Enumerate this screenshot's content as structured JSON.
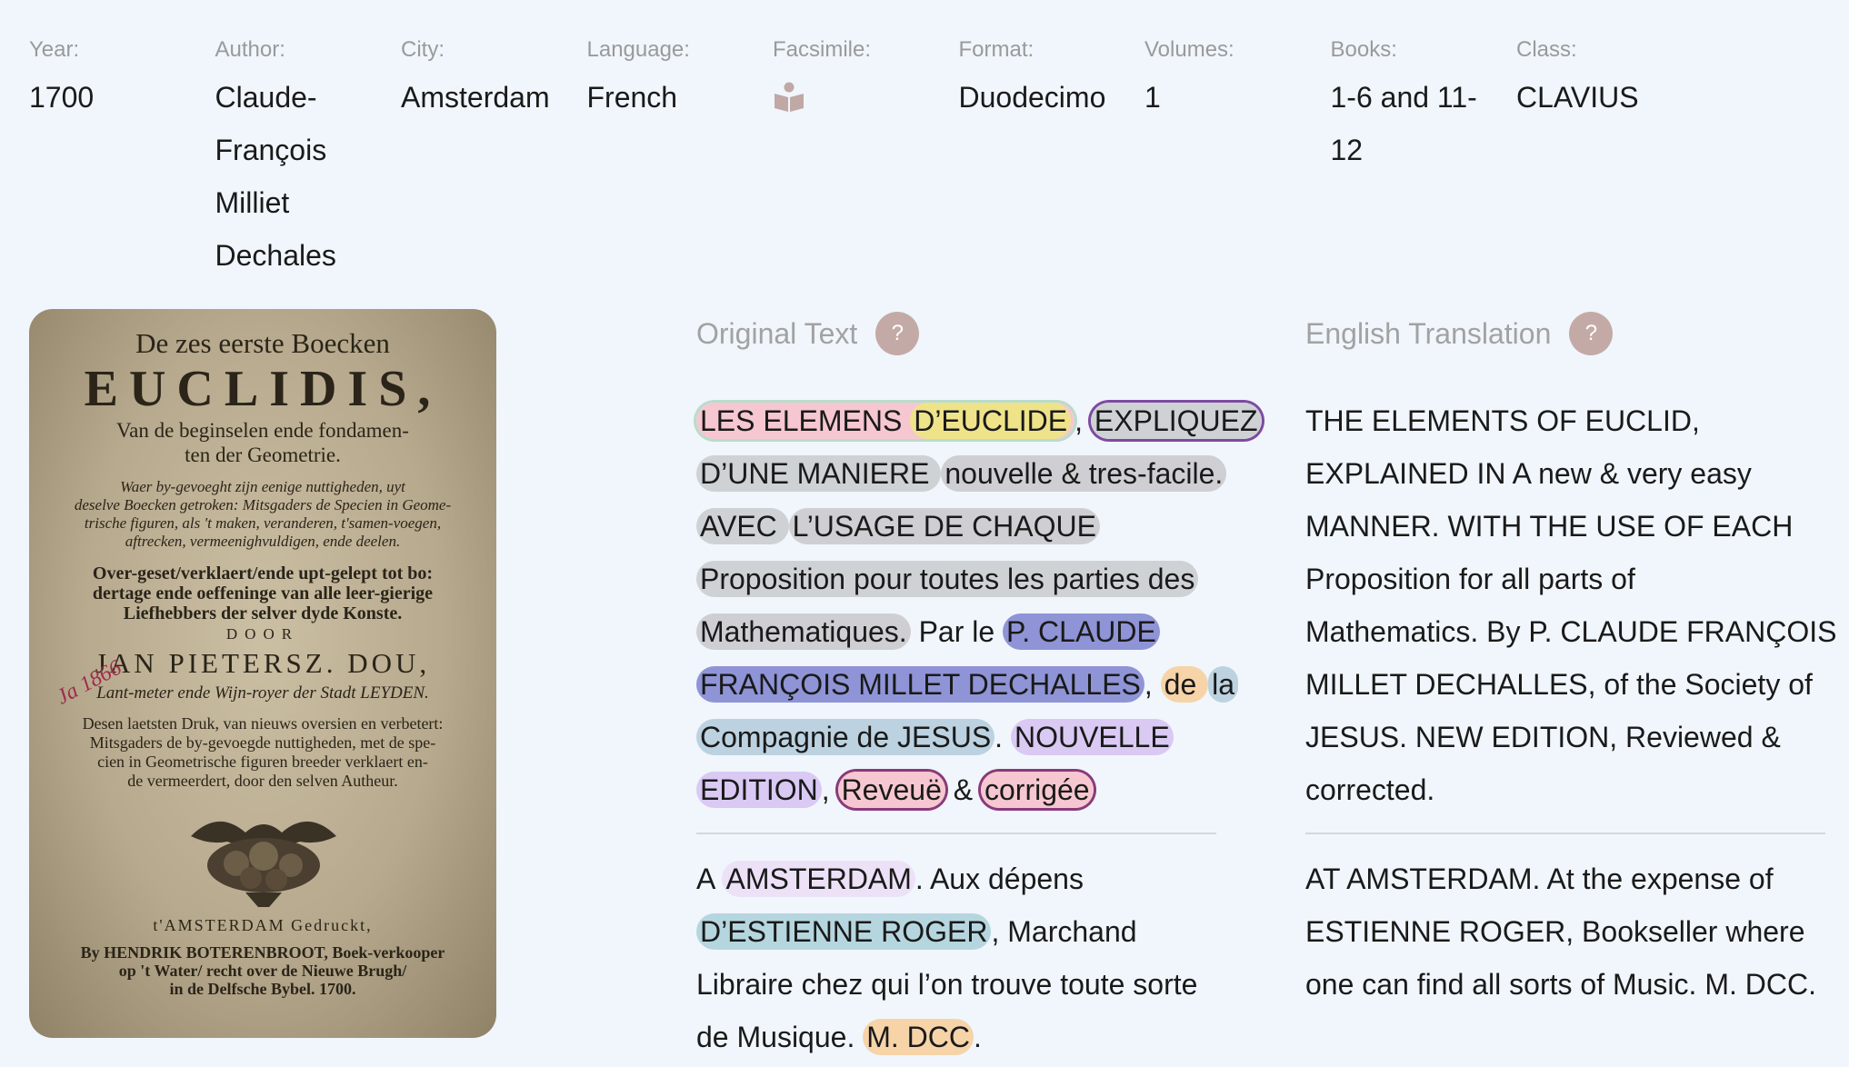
{
  "meta": {
    "year_label": "Year:",
    "year": "1700",
    "author_label": "Author:",
    "author_lines": [
      "Claude-",
      "François",
      "Milliet",
      "Dechales"
    ],
    "city_label": "City:",
    "city": "Amsterdam",
    "language_label": "Language:",
    "language": "French",
    "facsimile_label": "Facsimile:",
    "facsimile_icon": "book-open-icon",
    "format_label": "Format:",
    "format": "Duodecimo",
    "volumes_label": "Volumes:",
    "volumes": "1",
    "books_label": "Books:",
    "books_lines": [
      "1-6 and 11-",
      "12"
    ],
    "class_label": "Class:",
    "class": "CLAVIUS"
  },
  "scan": {
    "l1": "De zes eerste Boecken",
    "l2": "EUCLIDIS,",
    "l3": [
      "Van de beginselen ende fondamen-",
      "ten der Geometrie."
    ],
    "l4": [
      "Waer by-gevoeght zijn eenige nuttigheden, uyt",
      "deselve Boecken getroken: Mitsgaders de Specien in Geome-",
      "trische figuren, als 't maken, veranderen, t'samen-voegen,",
      "aftrecken, vermeenighvuldigen, ende deelen."
    ],
    "l5": [
      "Over-geset/verklaert/ende upt-gelept tot bo:",
      "dertage ende oeffeninge van alle leer-gierige",
      "Liefhebbers der selver dyde Konste."
    ],
    "l6": "DOOR",
    "l7": "JAN PIETERSZ. DOU,",
    "l8": "Lant-meter ende Wijn-royer der Stadt LEYDEN.",
    "l9": [
      "Desen laetsten Druk, van nieuws oversien en verbetert:",
      "Mitsgaders de by-gevoegde nuttigheden, met de spe-",
      "cien in Geometrische figuren breeder verklaert en-",
      "de vermeerdert, door den selven Autheur."
    ],
    "l10": "t'AMSTERDAM Gedruckt,",
    "l11": [
      "By HENDRIK BOTERENBROOT, Boek-verkooper",
      "op 't Water/ recht over de Nieuwe Brugh/",
      "in de Delfsche Bybel. 1700."
    ],
    "handwriting": "Ja 1866"
  },
  "original": {
    "title": "Original Text",
    "help": "?",
    "line1": {
      "a": "LES ELEMENS ",
      "b": "D’EUCLIDE",
      "c": ",",
      "d": "EXPLIQUEZ"
    },
    "line2": {
      "a": "D’UNE MANIERE ",
      "b": "nouvelle & tres-facile."
    },
    "line3": {
      "a": "AVEC ",
      "b": "L’USAGE DE CHAQUE"
    },
    "line4": "Proposition pour toutes les parties des",
    "line5": {
      "a": "Mathematiques.",
      "b": " Par le ",
      "c": "P. CLAUDE"
    },
    "line6": {
      "a": "FRANÇOIS MILLET DECHALLES",
      "b": ", ",
      "c": "de ",
      "d": "la"
    },
    "line7": {
      "a": "Compagnie de JESUS",
      "b": ". ",
      "c": "NOUVELLE"
    },
    "line8": {
      "a": "EDITION",
      "b": ", ",
      "c": "Reveuë",
      "d": " & ",
      "e": "corrigée"
    },
    "p2": {
      "line1": {
        "a": "A ",
        "b": "AMSTERDAM",
        "c": ". Aux dépens"
      },
      "line2": {
        "a": "D’ESTIENNE ROGER",
        "b": ", Marchand"
      },
      "line3": "Libraire chez qui l’on trouve toute sorte",
      "line4": {
        "a": "de Musique. ",
        "b": "M. DCC",
        "c": "."
      }
    }
  },
  "english": {
    "title": "English Translation",
    "help": "?",
    "lines": [
      "THE ELEMENTS OF EUCLID,",
      "EXPLAINED IN A new & very easy",
      "MANNER. WITH THE USE OF EACH",
      "Proposition for all parts of",
      "Mathematics. By P. CLAUDE FRANÇOIS",
      "MILLET DECHALLES, of the Society of",
      "JESUS. NEW EDITION, Reviewed &",
      "corrected."
    ],
    "p2_lines": [
      "AT AMSTERDAM. At the expense of",
      "ESTIENNE ROGER, Bookseller where",
      "one can find all sorts of Music. M. DCC."
    ]
  }
}
